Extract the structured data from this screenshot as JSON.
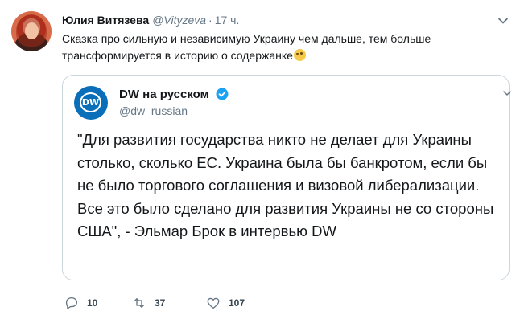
{
  "tweet": {
    "author_name": "Юлия Витязева",
    "author_handle": "@Vityzeva",
    "separator": "·",
    "time": "17 ч.",
    "text": "Сказка про сильную и независимую Украину чем дальше, тем больше трансформируется в историю о содержанке",
    "emoji_icon": "winking-face-emoji"
  },
  "quoted": {
    "name": "DW на русском",
    "handle": "@dw_russian",
    "logo_text": "DW",
    "text": "\"Для развития государства никто не делает для Украины столько, сколько ЕС. Украина была бы банкротом, если бы не было торгового соглашения и визовой либерализации. Все это было сделано для развития Украины не со стороны США\", - Эльмар Брок в интервью DW"
  },
  "actions": {
    "reply_count": "10",
    "retweet_count": "37",
    "like_count": "107"
  },
  "colors": {
    "text": "#14171a",
    "secondary": "#657786",
    "border": "#ccd6dd",
    "verified": "#1da1f2",
    "dw_blue": "#0a6fb8"
  }
}
